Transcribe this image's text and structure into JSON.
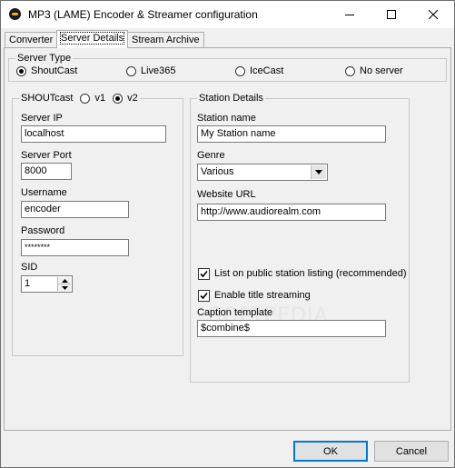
{
  "window": {
    "title": "MP3 (LAME) Encoder & Streamer configuration"
  },
  "tabs": [
    {
      "label": "Converter"
    },
    {
      "label": "Server Details"
    },
    {
      "label": "Stream Archive"
    }
  ],
  "server_type": {
    "label": "Server Type",
    "options": [
      "ShoutCast",
      "Live365",
      "IceCast",
      "No server"
    ],
    "selected": "ShoutCast"
  },
  "shoutcast": {
    "label": "SHOUTcast",
    "versions": [
      "v1",
      "v2"
    ],
    "selected_version": "v2",
    "server_ip_label": "Server IP",
    "server_ip": "localhost",
    "server_port_label": "Server Port",
    "server_port": "8000",
    "username_label": "Username",
    "username": "encoder",
    "password_label": "Password",
    "password": "********",
    "sid_label": "SID",
    "sid": "1"
  },
  "station": {
    "label": "Station Details",
    "name_label": "Station name",
    "name": "My Station name",
    "genre_label": "Genre",
    "genre": "Various",
    "url_label": "Website URL",
    "url": "http://www.audiorealm.com",
    "public_listing_label": "List on public station listing (recommended)",
    "public_listing": true,
    "title_streaming_label": "Enable title streaming",
    "title_streaming": true,
    "caption_label": "Caption template",
    "caption": "$combine$"
  },
  "watermark": "SOFTPEDIA",
  "buttons": {
    "ok": "OK",
    "cancel": "Cancel"
  }
}
